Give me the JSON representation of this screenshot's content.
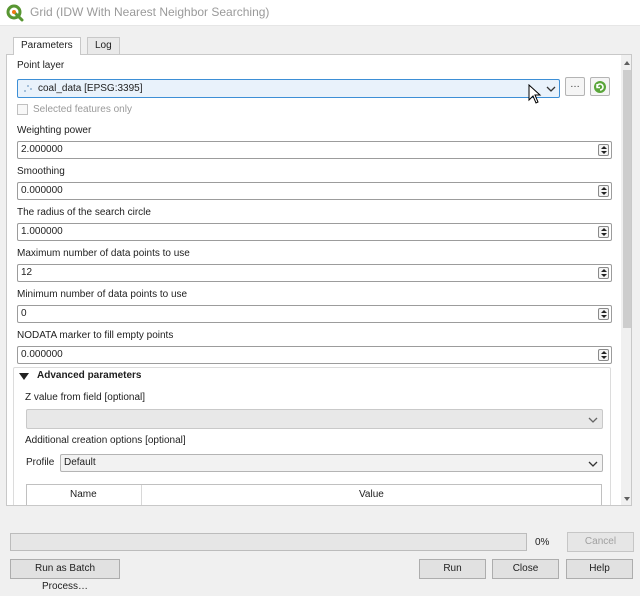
{
  "window": {
    "title": "Grid (IDW With Nearest Neighbor Searching)"
  },
  "tabs": [
    {
      "label": "Parameters",
      "active": true
    },
    {
      "label": "Log",
      "active": false
    }
  ],
  "params": {
    "point_layer": {
      "label": "Point layer",
      "value": "coal_data [EPSG:3395]"
    },
    "selected_only": {
      "label": "Selected features only",
      "checked": false
    },
    "weighting_power": {
      "label": "Weighting power",
      "value": "2.000000"
    },
    "smoothing": {
      "label": "Smoothing",
      "value": "0.000000"
    },
    "radius": {
      "label": "The radius of the search circle",
      "value": "1.000000"
    },
    "max_points": {
      "label": "Maximum number of data points to use",
      "value": "12"
    },
    "min_points": {
      "label": "Minimum number of data points to use",
      "value": "0"
    },
    "nodata": {
      "label": "NODATA marker to fill empty points",
      "value": "0.000000"
    }
  },
  "advanced": {
    "title": "Advanced parameters",
    "z_field_label": "Z value from field [optional]",
    "creation_options_label": "Additional creation options [optional]",
    "profile_label": "Profile",
    "profile_value": "Default",
    "table_columns": [
      "Name",
      "Value"
    ]
  },
  "buttons": {
    "browse": "…",
    "batch": "Run as Batch Process…",
    "run": "Run",
    "close": "Close",
    "help": "Help",
    "cancel": "Cancel"
  },
  "progress": {
    "value": 0,
    "label": "0%"
  },
  "colors": {
    "accent": "#3d8fd6",
    "progress": "#06b025",
    "qgis_green": "#589632"
  }
}
